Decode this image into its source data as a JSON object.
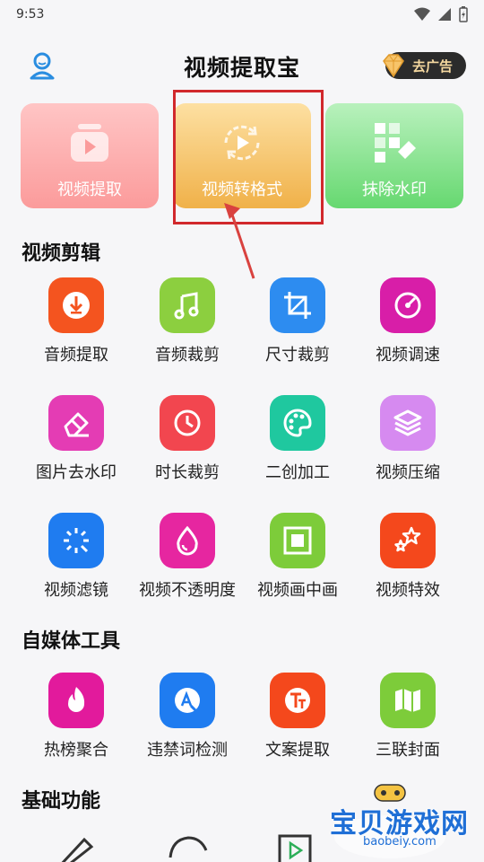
{
  "status_bar": {
    "time": "9:53"
  },
  "header": {
    "title": "视频提取宝",
    "remove_ads_label": "去广告"
  },
  "features": [
    {
      "label": "视频提取",
      "icon": "video-play-icon"
    },
    {
      "label": "视频转格式",
      "icon": "convert-cycle-icon"
    },
    {
      "label": "抹除水印",
      "icon": "eraser-grid-icon"
    }
  ],
  "sections": {
    "video_edit": {
      "title": "视频剪辑",
      "tools": [
        {
          "label": "音频提取",
          "icon": "audio-extract-icon",
          "color": "#f4541f"
        },
        {
          "label": "音频裁剪",
          "icon": "music-note-icon",
          "color": "#8ccf3f"
        },
        {
          "label": "尺寸裁剪",
          "icon": "crop-icon",
          "color": "#2d8cf0"
        },
        {
          "label": "视频调速",
          "icon": "speed-dial-icon",
          "color": "#d81ea8"
        },
        {
          "label": "图片去水印",
          "icon": "eraser-icon",
          "color": "#e43cb4"
        },
        {
          "label": "时长裁剪",
          "icon": "clock-icon",
          "color": "#f2464f"
        },
        {
          "label": "二创加工",
          "icon": "palette-icon",
          "color": "#1fc89f"
        },
        {
          "label": "视频压缩",
          "icon": "layers-icon",
          "color": "#d68af0"
        },
        {
          "label": "视频滤镜",
          "icon": "magic-wand-icon",
          "color": "#1f7cf0"
        },
        {
          "label": "视频不透明度",
          "icon": "droplet-icon",
          "color": "#e626a0"
        },
        {
          "label": "视频画中画",
          "icon": "picture-in-picture-icon",
          "color": "#7dcc3a"
        },
        {
          "label": "视频特效",
          "icon": "stars-icon",
          "color": "#f4481c"
        }
      ]
    },
    "self_media": {
      "title": "自媒体工具",
      "tools": [
        {
          "label": "热榜聚合",
          "icon": "fire-icon",
          "color": "#e21a9c"
        },
        {
          "label": "违禁词检测",
          "icon": "search-a-icon",
          "color": "#1f7cf0"
        },
        {
          "label": "文案提取",
          "icon": "text-tt-icon",
          "color": "#f4481c"
        },
        {
          "label": "三联封面",
          "icon": "map-fold-icon",
          "color": "#7dcc3a"
        }
      ]
    },
    "basic": {
      "title": "基础功能"
    }
  },
  "watermark": {
    "text": "宝贝游戏网",
    "url": "baobeiy.com"
  }
}
